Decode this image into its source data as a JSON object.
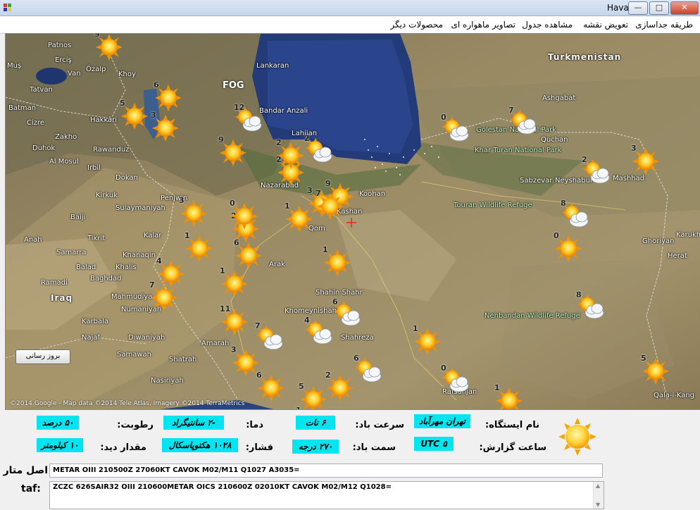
{
  "window": {
    "title": "Hava",
    "min": "—",
    "max": "□",
    "close": "✕"
  },
  "menu": {
    "items": [
      "طریقه جداسازی",
      "تعویض نقشه",
      "مشاهده جدول",
      "تصاویر ماهواره ای",
      "محصولات دیگر"
    ]
  },
  "map": {
    "refresh_label": "بروز رسانی",
    "copyright": "©2014 Google - Map data ©2014 Tele Atlas, Imagery ©2014 TerraMetrics",
    "fog_label": "FOG",
    "labels": {
      "turkmenistan": "Turkmenistan",
      "iraq": "Iraq",
      "patnos": "Patnos",
      "ercis": "Erciş",
      "van": "Van",
      "mus": "Muş",
      "tatvan": "Tatvan",
      "batman": "Batman",
      "ozalp": "Özalp",
      "khoy": "Khoy",
      "hakkari": "Hakkâri",
      "cizre": "Cizre",
      "zakho": "Zakho",
      "duhok": "Duhok",
      "rawanduz": "Rawanduz",
      "almosul": "Al Mosul",
      "irbil": "Irbil",
      "dokan": "Dokan",
      "kirkuk": "Kirkuk",
      "sulaymaniyah": "Sulaymaniyah",
      "penjwin": "Penjwin",
      "baiji": "Baiji",
      "tikrit": "Tikrit",
      "kalar": "Kalar",
      "anah": "Anah",
      "samarra": "Samarra",
      "khanaqin": "Khanaqin",
      "balad": "Balad",
      "khalis": "Khalis",
      "ramadi": "Ramadi",
      "baghdad": "Baghdad",
      "mahmudiya": "Mahmudiya",
      "numaniyah": "Numaniyah",
      "karbala": "Karbala",
      "najaf": "Najaf",
      "diwaniyah": "Diwaniyah",
      "amarah": "Amarah",
      "samawah": "Samawah",
      "shatrah": "Shatrah",
      "nasiriyah": "Nasiriyah",
      "lankaran": "Lankaran",
      "bandaranzali": "Bandar Anzali",
      "lahijan": "Lahijan",
      "nazarabad": "Nazarabad",
      "qom": "Qom",
      "kashan": "Kashan",
      "arak": "Arak",
      "shahinshahr": "Shahin Shahr",
      "khomeynishahr": "Khomeynishahr",
      "shahreza": "Shahreza",
      "koohan": "Koohan",
      "ashgabat": "Ashgabat",
      "golestan": "Golestan National Park",
      "kharturan": "Khar Turan National Park",
      "touran": "Touran Wildlife Refuge",
      "quchan": "Quchan",
      "sabzevar": "Sabzevar",
      "neyshabur": "Neyshabur",
      "mashhad": "Mashhad",
      "herat": "Herat",
      "karukh": "Karukh",
      "ghoriyan": "Ghoriyan",
      "nehbandan": "Nehbandan Wildlife Refuge",
      "rafsanjan": "Rafsanjan",
      "qalatikang": "Qala-i-Kang"
    }
  },
  "station": {
    "name_label": "نام ایستگاه:",
    "name_value": "تهران مهرآباد",
    "report_time_label": "ساعت گزارش:",
    "report_time_value": "UTC ۵",
    "wind_speed_label": "سرعت باد:",
    "wind_speed_value": "۶ نات",
    "wind_dir_label": "سمت باد:",
    "wind_dir_value": "۲۷۰ درجه",
    "temp_label": "دما:",
    "temp_value": "-۲ سانتیگراد",
    "pressure_label": "فشار:",
    "pressure_value": "۱۰۲۸ هکتوپاسکال",
    "humidity_label": "رطوبت:",
    "humidity_value": "۵۰ درصد",
    "visibility_label": "مقدار دید:",
    "visibility_value": "۱۰ کیلومتر",
    "metar_label": "اصل متار",
    "metar_value": "METAR OIII 210500Z 27060KT CAVOK M02/M11 Q1027 A3035=",
    "taf_label": "taf:",
    "taf_value": "ZCZC 626SAIR32 OIII 210600METAR OICS 210600Z 02010KT CAVOK M02/M12 Q1028="
  },
  "weather_markers": [
    {
      "n": "9",
      "t": "sun"
    },
    {
      "n": "6",
      "t": "sun"
    },
    {
      "n": "5",
      "t": "sun"
    },
    {
      "n": "3",
      "t": "sun"
    },
    {
      "n": "12",
      "t": "cloud"
    },
    {
      "n": "2",
      "t": "cloud"
    },
    {
      "n": "9",
      "t": "sun"
    },
    {
      "n": "2",
      "t": "sun"
    },
    {
      "n": "3",
      "t": "sun"
    },
    {
      "n": "2",
      "t": "sun"
    },
    {
      "n": "0",
      "t": "sun"
    },
    {
      "n": "1",
      "t": "sun"
    },
    {
      "n": "3",
      "t": "sun"
    },
    {
      "n": "9",
      "t": "sun"
    },
    {
      "n": "7",
      "t": "sun"
    },
    {
      "n": "1",
      "t": "sun"
    },
    {
      "n": "6",
      "t": "sun"
    },
    {
      "n": "1",
      "t": "sun"
    },
    {
      "n": "4",
      "t": "sun"
    },
    {
      "n": "7",
      "t": "sun"
    },
    {
      "n": "1",
      "t": "sun"
    },
    {
      "n": "11",
      "t": "sun"
    },
    {
      "n": "7",
      "t": "cloud"
    },
    {
      "n": "3",
      "t": "sun"
    },
    {
      "n": "6",
      "t": "sun"
    },
    {
      "n": "6",
      "t": "cloud"
    },
    {
      "n": "4",
      "t": "cloud"
    },
    {
      "n": "1",
      "t": "sun"
    },
    {
      "n": "6",
      "t": "cloud"
    },
    {
      "n": "2",
      "t": "sun"
    },
    {
      "n": "5",
      "t": "sun"
    },
    {
      "n": "0",
      "t": "cloud"
    },
    {
      "n": "1",
      "t": "sun"
    },
    {
      "n": "0",
      "t": "cloud"
    },
    {
      "n": "7",
      "t": "cloud"
    },
    {
      "n": "8",
      "t": "cloud"
    },
    {
      "n": "2",
      "t": "cloud"
    },
    {
      "n": "3",
      "t": "sun"
    },
    {
      "n": "0",
      "t": "sun"
    },
    {
      "n": "8",
      "t": "cloud"
    },
    {
      "n": "5",
      "t": "sun"
    },
    {
      "n": "2",
      "t": "sun"
    },
    {
      "n": "9",
      "t": "sun"
    },
    {
      "n": "1",
      "t": "sun"
    }
  ]
}
